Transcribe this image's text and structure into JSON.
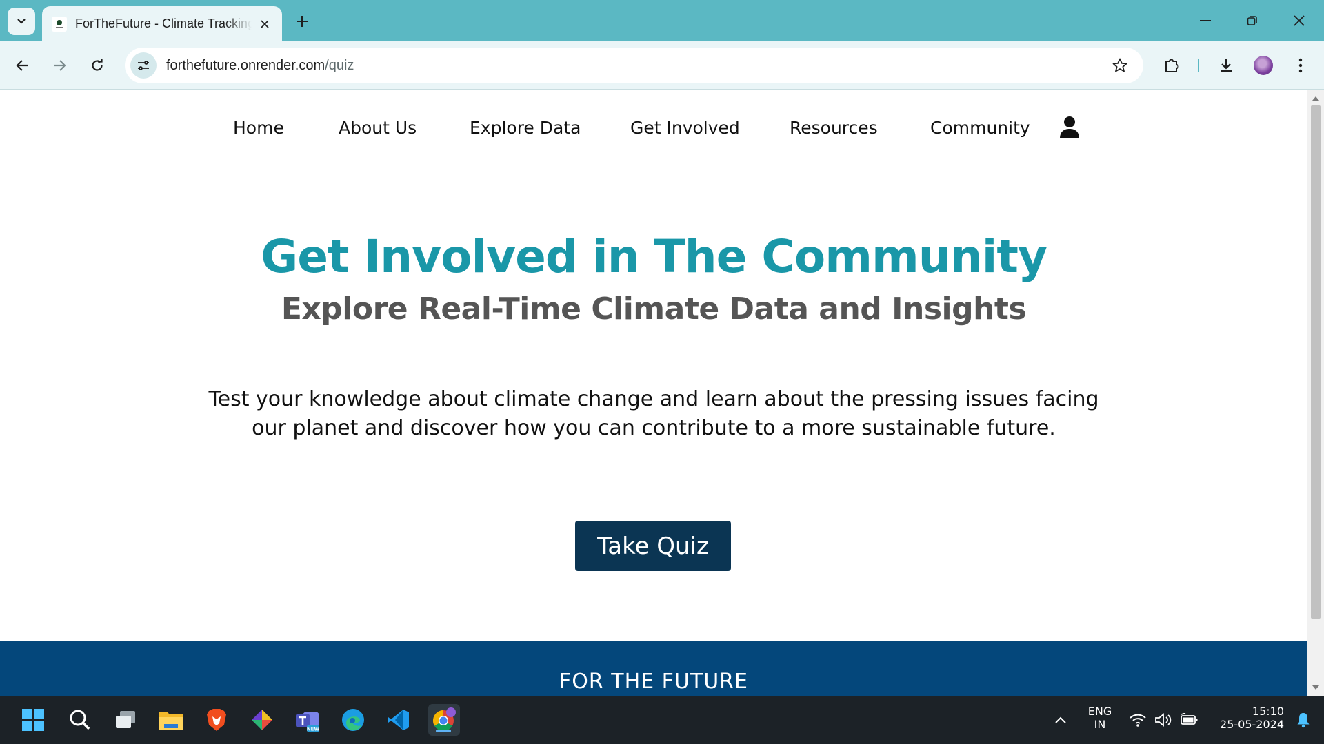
{
  "browser": {
    "tab_title": "ForTheFuture - Climate Tracking",
    "url_host": "forthefuture.onrender.com",
    "url_path": "/quiz",
    "accent_color": "#5bb8c3"
  },
  "site_nav": {
    "items": [
      "Home",
      "About Us",
      "Explore Data",
      "Get Involved",
      "Resources",
      "Community"
    ],
    "user_icon": "user-icon"
  },
  "hero": {
    "title": "Get Involved in The Community",
    "subtitle": "Explore Real-Time Climate Data and Insights",
    "description": "Test your knowledge about climate change and learn about the pressing issues facing our planet and discover how you can contribute to a more sustainable future.",
    "button_label": "Take Quiz",
    "title_color": "#1a97a8",
    "button_color": "#0b3553"
  },
  "footer": {
    "title": "FOR THE FUTURE",
    "color": "#04477b"
  },
  "taskbar": {
    "apps": [
      "windows-start-icon",
      "search-icon",
      "task-view-icon",
      "file-explorer-icon",
      "brave-icon",
      "git-icon",
      "teams-icon",
      "edge-icon",
      "vscode-icon",
      "chrome-icon"
    ],
    "language_top": "ENG",
    "language_bottom": "IN",
    "time": "15:10",
    "date": "25-05-2024"
  }
}
